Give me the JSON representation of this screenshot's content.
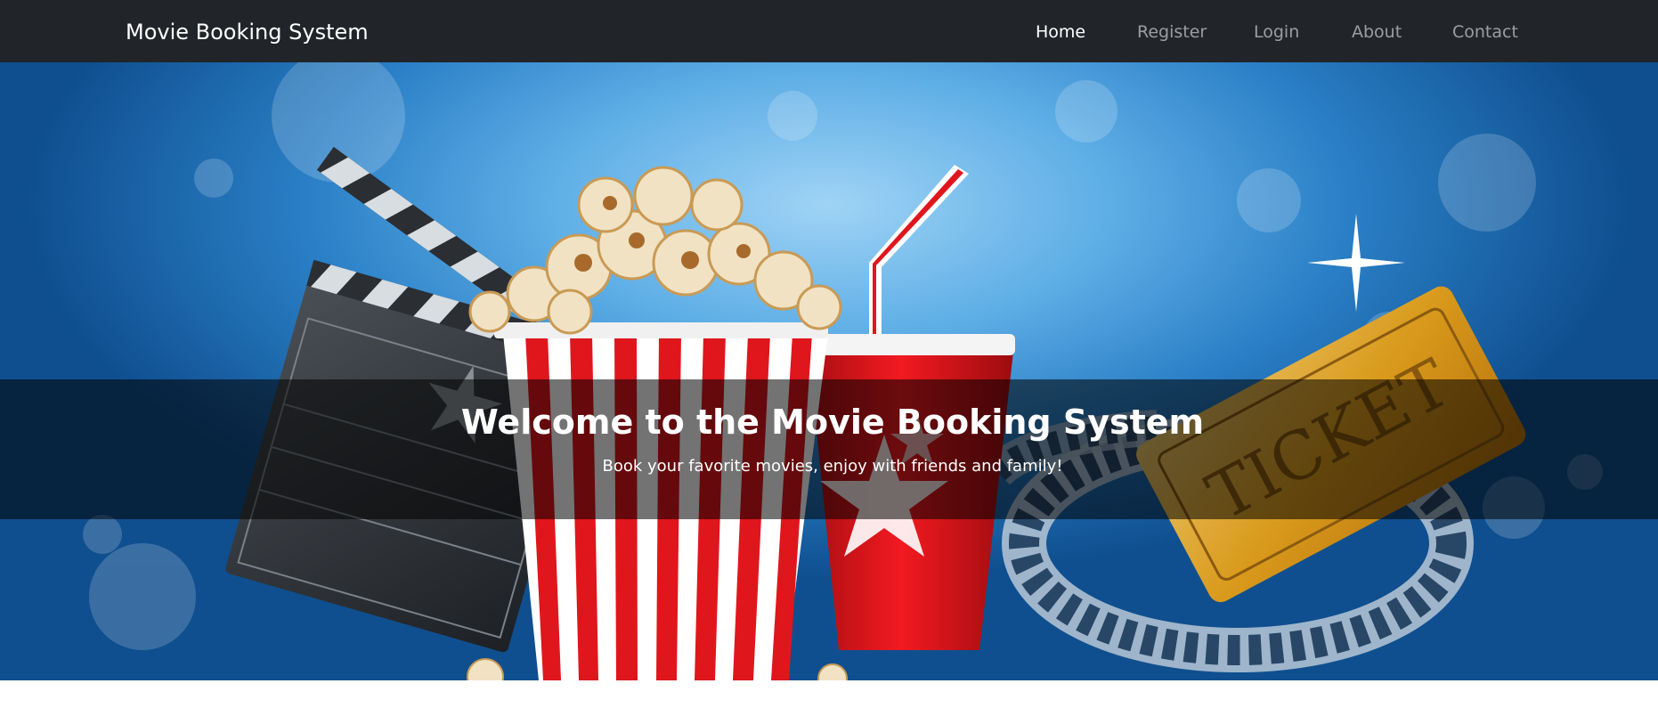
{
  "navbar": {
    "brand": "Movie Booking System",
    "links": [
      {
        "label": "Home",
        "active": true
      },
      {
        "label": "Register",
        "active": false
      },
      {
        "label": "Login",
        "active": false
      },
      {
        "label": "About",
        "active": false
      },
      {
        "label": "Contact",
        "active": false
      }
    ]
  },
  "hero": {
    "title": "Welcome to the Movie Booking System",
    "subtitle": "Book your favorite movies, enjoy with friends and family!",
    "image_items": [
      "clapperboard-icon",
      "popcorn-icon",
      "soda-cup-icon",
      "film-reel-icon",
      "ticket-icon"
    ],
    "ticket_text": "TICKET"
  },
  "colors": {
    "navbar_bg": "#212529",
    "nav_active": "#ffffff",
    "nav_inactive": "#9a9da0",
    "hero_blue": "#2a7fc6",
    "popcorn_red": "#e0161d"
  }
}
